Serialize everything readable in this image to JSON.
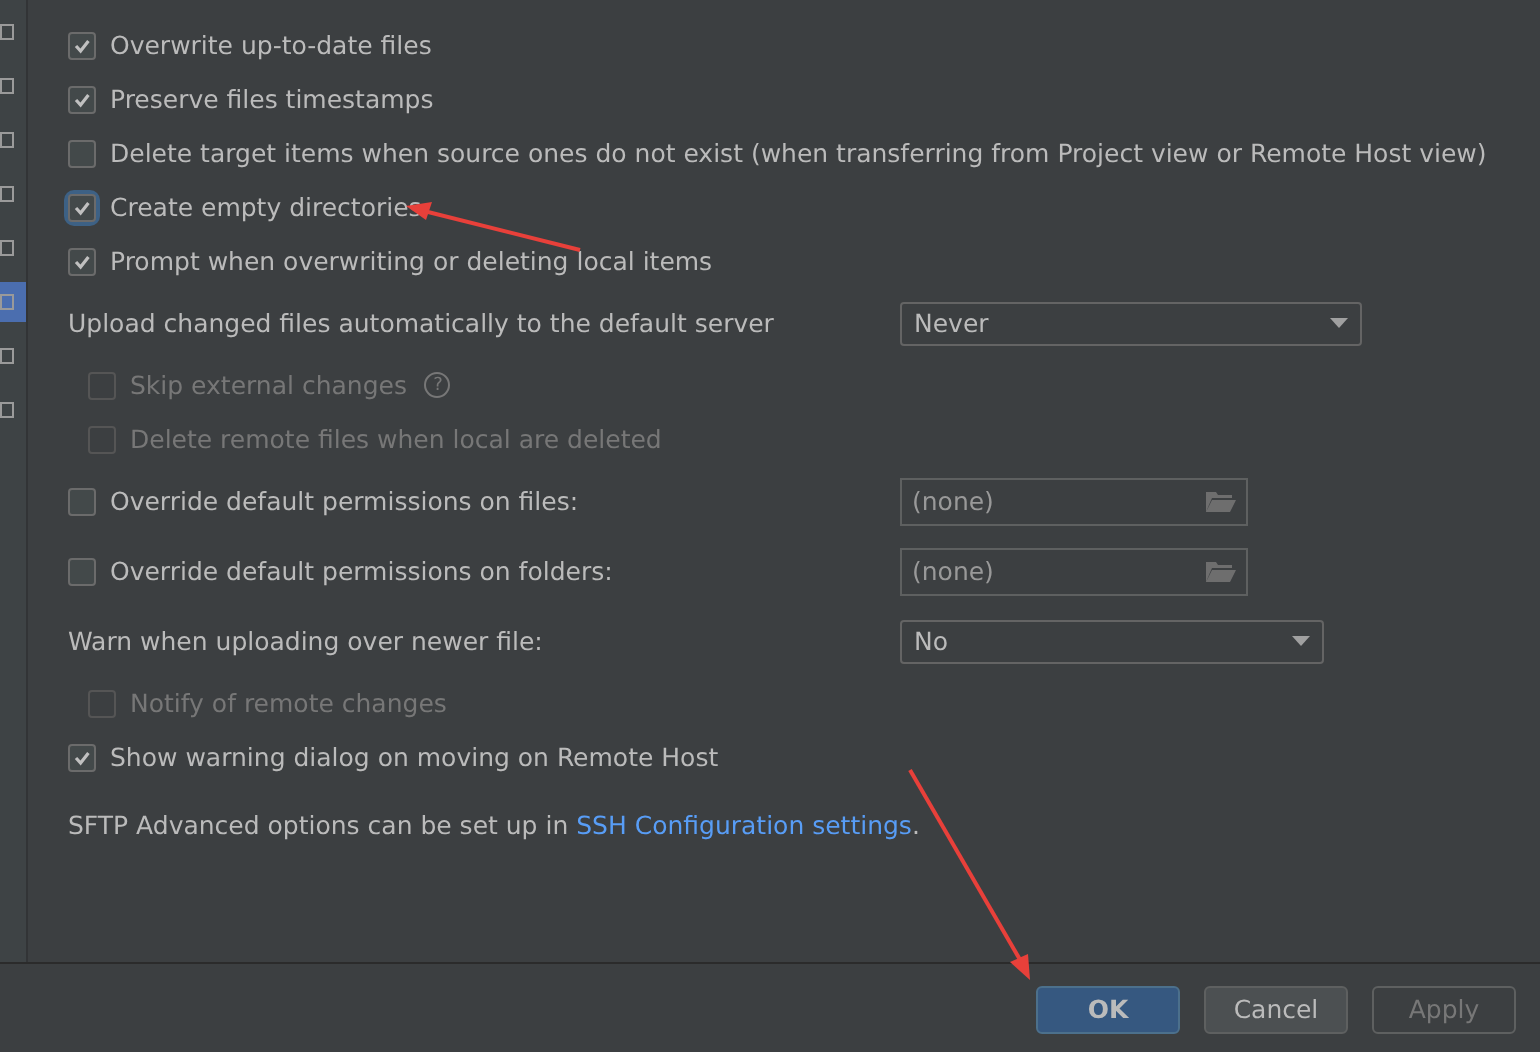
{
  "sidebar": {
    "items": [
      {
        "selected": false
      },
      {
        "selected": false
      },
      {
        "selected": false
      },
      {
        "selected": false
      },
      {
        "selected": false
      },
      {
        "selected": true
      },
      {
        "selected": false
      },
      {
        "selected": false
      }
    ]
  },
  "options": [
    {
      "kind": "checkbox",
      "label": "Overwrite up-to-date files",
      "checked": true,
      "focused": false,
      "disabled": false
    },
    {
      "kind": "checkbox",
      "label": "Preserve files timestamps",
      "checked": true,
      "focused": false,
      "disabled": false
    },
    {
      "kind": "checkbox",
      "label": "Delete target items when source ones do not exist (when transferring from Project view or Remote Host view)",
      "checked": false,
      "focused": false,
      "disabled": false
    },
    {
      "kind": "checkbox",
      "label": "Create empty directories",
      "checked": true,
      "focused": true,
      "disabled": false
    },
    {
      "kind": "checkbox",
      "label": "Prompt when overwriting or deleting local items",
      "checked": true,
      "focused": false,
      "disabled": false
    },
    {
      "kind": "dropdown",
      "label": "Upload changed files automatically to the default server",
      "value": "Never",
      "wide": true,
      "children": [
        {
          "kind": "checkbox",
          "label": "Skip external changes",
          "checked": false,
          "focused": false,
          "disabled": true,
          "help": "?"
        },
        {
          "kind": "checkbox",
          "label": "Delete remote files when local are deleted",
          "checked": false,
          "focused": false,
          "disabled": true
        }
      ]
    },
    {
      "kind": "path",
      "label": "Override default permissions on files:",
      "checked": false,
      "value": "(none)"
    },
    {
      "kind": "path",
      "label": "Override default permissions on folders:",
      "checked": false,
      "value": "(none)"
    },
    {
      "kind": "dropdown",
      "label": "Warn when uploading over newer file:",
      "value": "No",
      "wide": false,
      "children": [
        {
          "kind": "checkbox",
          "label": "Notify of remote changes",
          "checked": false,
          "focused": false,
          "disabled": true
        }
      ]
    },
    {
      "kind": "checkbox",
      "label": "Show warning dialog on moving on Remote Host",
      "checked": true,
      "focused": false,
      "disabled": false
    },
    {
      "kind": "note",
      "text": "SFTP Advanced options can be set up in",
      "link": "SSH Configuration settings",
      "after": "."
    }
  ],
  "buttons": [
    {
      "label": "OK",
      "default": true,
      "disabled": false
    },
    {
      "label": "Cancel",
      "default": false,
      "disabled": false
    },
    {
      "label": "Apply",
      "default": false,
      "disabled": true
    }
  ]
}
